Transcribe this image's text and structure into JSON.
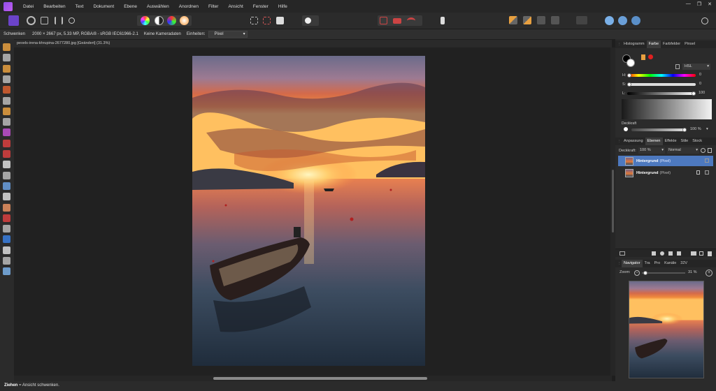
{
  "menu": {
    "items": [
      "Datei",
      "Bearbeiten",
      "Text",
      "Dokument",
      "Ebene",
      "Auswählen",
      "Anordnen",
      "Filter",
      "Ansicht",
      "Fenster",
      "Hilfe"
    ],
    "window_controls": [
      "—",
      "❐",
      "✕"
    ]
  },
  "context": {
    "tool": "Schwenken",
    "info": "2000 × 2667 px, 5.33 MP, RGBA/8 - sRGB IEC61966-2.1",
    "camera": "Keine Kameradaten",
    "units_label": "Einheiten:",
    "units_value": "Pixel"
  },
  "document": {
    "tab_title": "pexels-irena-khrupina-2677280.jpg [Geändert] (31.3%)"
  },
  "status": {
    "key": "Ziehen",
    "text": " = Ansicht schwenken."
  },
  "color_panel": {
    "tabs": [
      "Histogramm",
      "Farbe",
      "Farbfelder",
      "Pinsel"
    ],
    "active_tab": "Farbe",
    "mode": "HSL",
    "h_label": "H:",
    "h_value": "0",
    "s_label": "S:",
    "s_value": "0",
    "l_label": "L:",
    "l_value": "100",
    "opacity_label": "Deckkraft",
    "opacity_value": "100 %"
  },
  "layers_panel": {
    "tabs": [
      "Anpassung",
      "Ebenen",
      "Effekte",
      "Stile",
      "Stock"
    ],
    "active_tab": "Ebenen",
    "opacity_label": "Deckkraft:",
    "opacity_value": "100 %",
    "blend_mode": "Normal",
    "layers": [
      {
        "name": "Hintergrund",
        "type": "(Pixel)",
        "selected": true
      },
      {
        "name": "Hintergrund",
        "type": "(Pixel)",
        "selected": false
      }
    ]
  },
  "navigator_panel": {
    "tabs": [
      "Navigator",
      "Tra",
      "Pro",
      "Kanäle",
      "32V"
    ],
    "active_tab": "Navigator",
    "zoom_label": "Zoom:",
    "zoom_value": "31 %"
  },
  "colors": {
    "accent": "#7b4fe0",
    "selected_layer": "#4d79bf",
    "panel_bg": "#2b2b2b",
    "canvas_bg": "#212121"
  }
}
